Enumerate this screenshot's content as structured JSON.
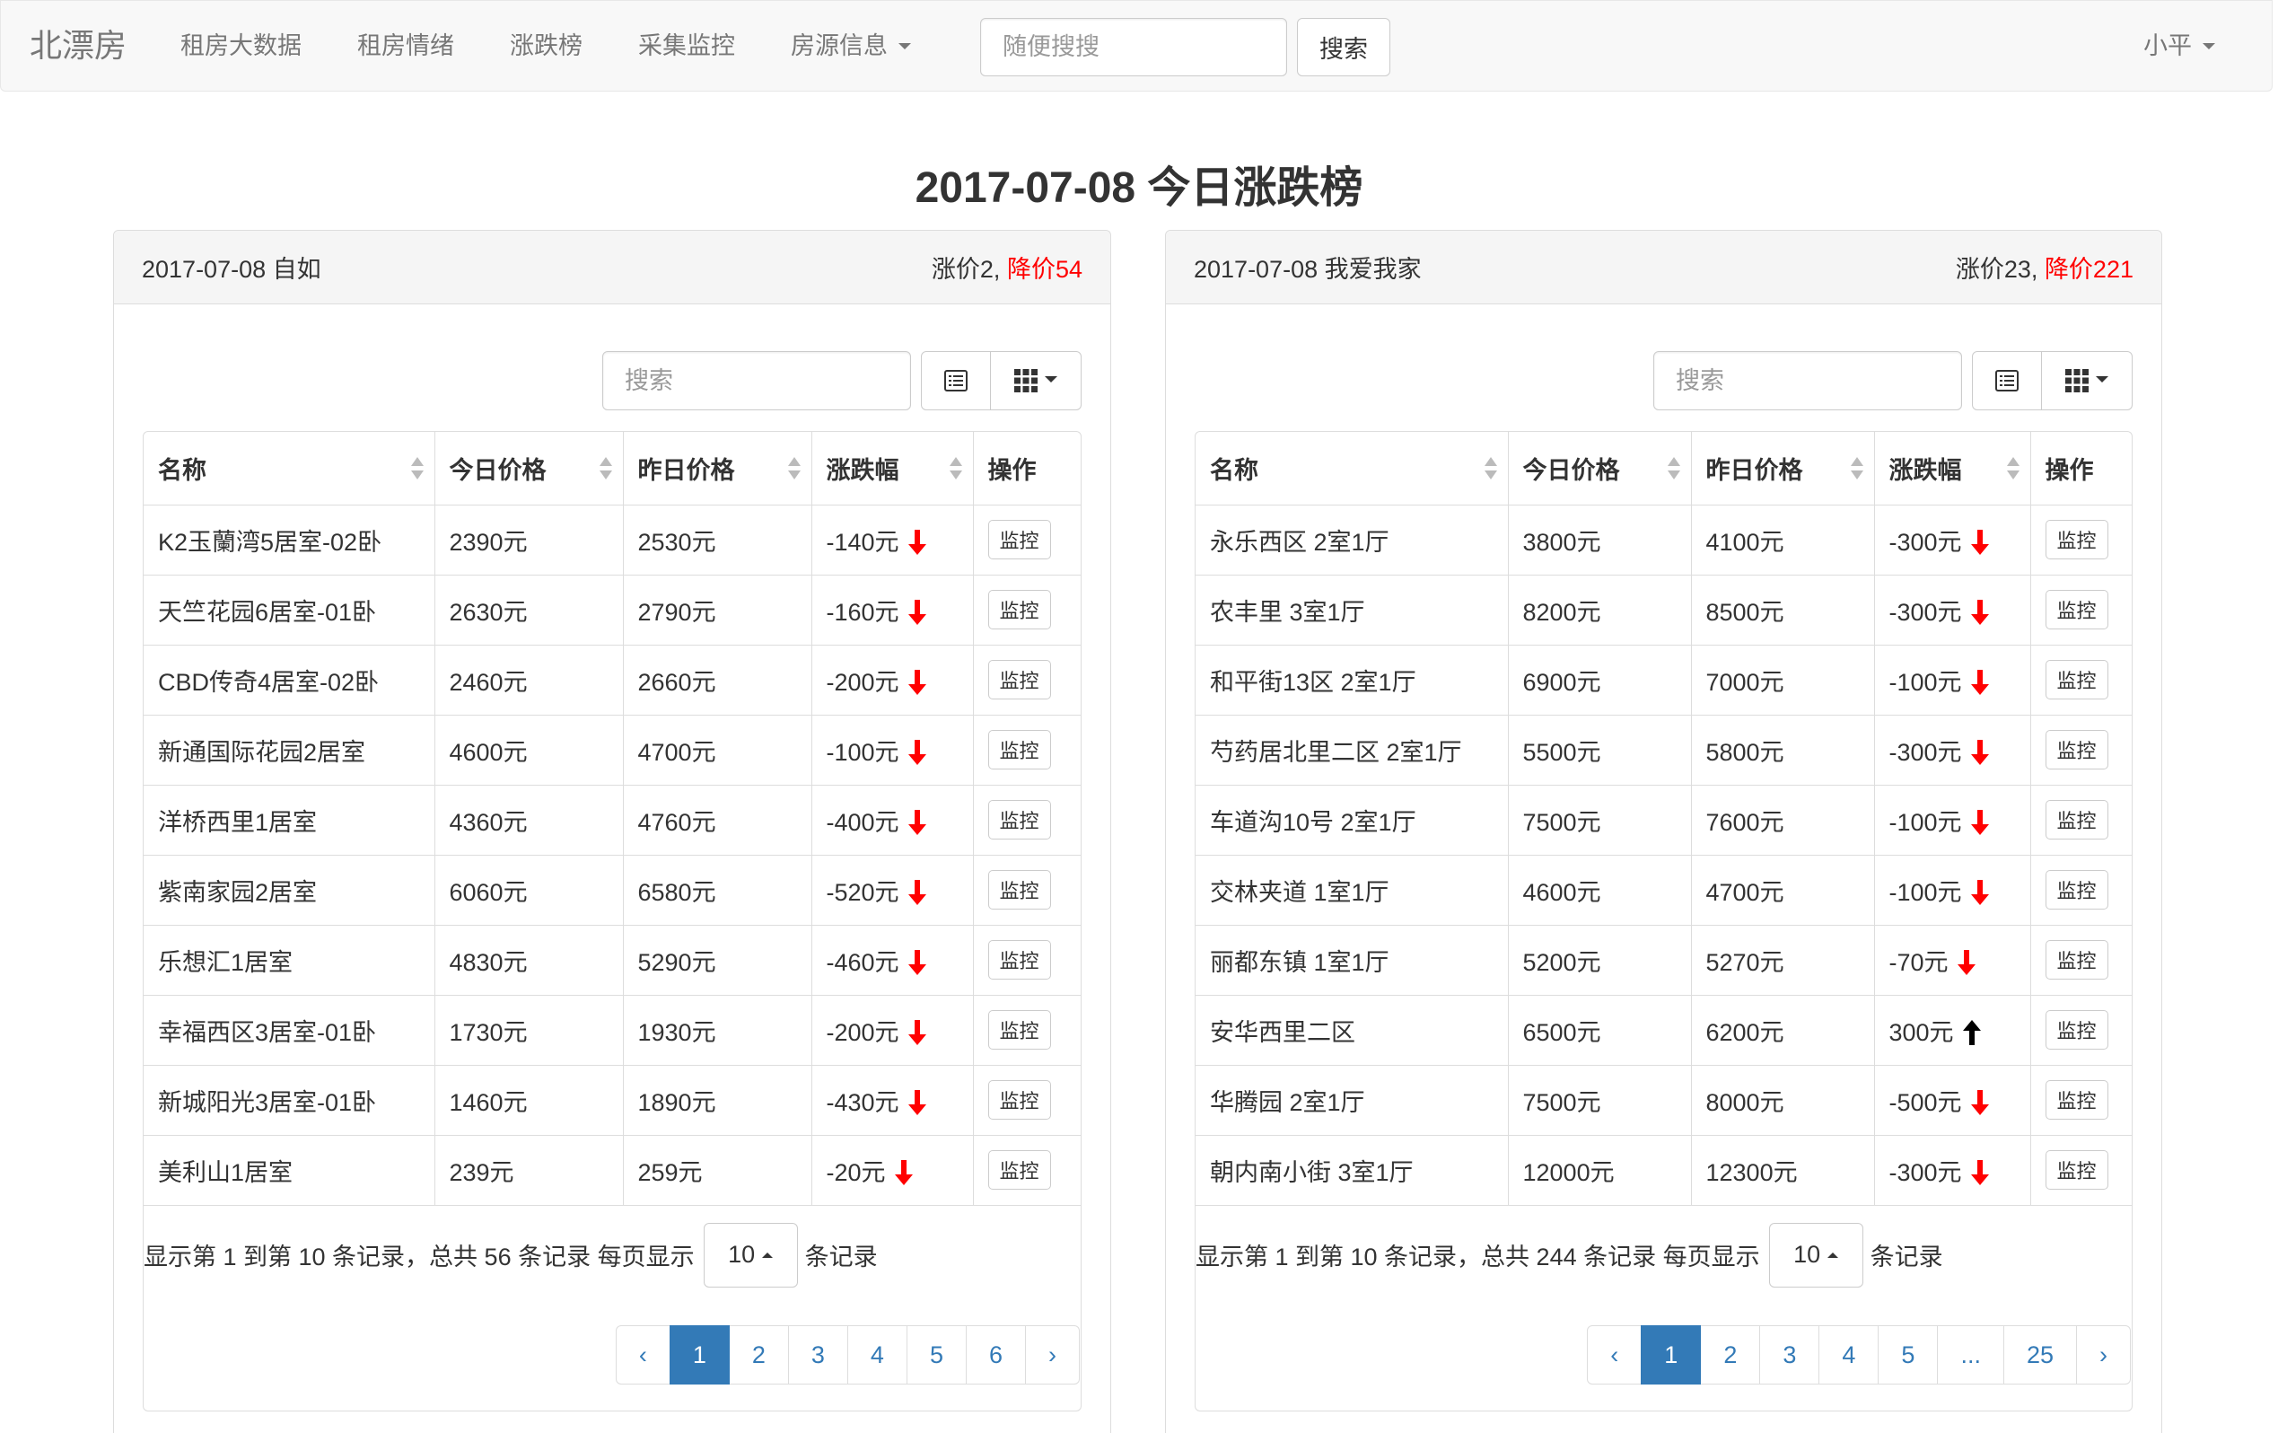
{
  "navbar": {
    "brand": "北漂房",
    "items": [
      {
        "label": "租房大数据"
      },
      {
        "label": "租房情绪"
      },
      {
        "label": "涨跌榜"
      },
      {
        "label": "采集监控"
      },
      {
        "label": "房源信息"
      }
    ],
    "search_placeholder": "随便搜搜",
    "search_button": "搜索",
    "user": "小平"
  },
  "page_title": "2017-07-08 今日涨跌榜",
  "colors": {
    "accent": "#337ab7",
    "fall": "#ff0000",
    "rise": "#000000"
  },
  "panels": [
    {
      "title": "2017-07-08 自如",
      "rise_label": "涨价2,",
      "fall_label": "降价54",
      "search_placeholder": "搜索",
      "columns": [
        "名称",
        "今日价格",
        "昨日价格",
        "涨跌幅",
        "操作"
      ],
      "action_label": "监控",
      "rows": [
        {
          "name": "K2玉蘭湾5居室-02卧",
          "today": "2390元",
          "yesterday": "2530元",
          "change": "-140元",
          "icon": "arrow-down"
        },
        {
          "name": "天竺花园6居室-01卧",
          "today": "2630元",
          "yesterday": "2790元",
          "change": "-160元",
          "icon": "arrow-down"
        },
        {
          "name": "CBD传奇4居室-02卧",
          "today": "2460元",
          "yesterday": "2660元",
          "change": "-200元",
          "icon": "arrow-down"
        },
        {
          "name": "新通国际花园2居室",
          "today": "4600元",
          "yesterday": "4700元",
          "change": "-100元",
          "icon": "arrow-down"
        },
        {
          "name": "洋桥西里1居室",
          "today": "4360元",
          "yesterday": "4760元",
          "change": "-400元",
          "icon": "arrow-down"
        },
        {
          "name": "紫南家园2居室",
          "today": "6060元",
          "yesterday": "6580元",
          "change": "-520元",
          "icon": "arrow-down"
        },
        {
          "name": "乐想汇1居室",
          "today": "4830元",
          "yesterday": "5290元",
          "change": "-460元",
          "icon": "arrow-down"
        },
        {
          "name": "幸福西区3居室-01卧",
          "today": "1730元",
          "yesterday": "1930元",
          "change": "-200元",
          "icon": "arrow-down"
        },
        {
          "name": "新城阳光3居室-01卧",
          "today": "1460元",
          "yesterday": "1890元",
          "change": "-430元",
          "icon": "arrow-down"
        },
        {
          "name": "美利山1居室",
          "today": "239元",
          "yesterday": "259元",
          "change": "-20元",
          "icon": "arrow-down"
        }
      ],
      "pagination": {
        "info": "显示第 1 到第 10 条记录，总共 56 条记录 每页显示",
        "page_size": "10",
        "suffix": "条记录",
        "prev": "‹",
        "next": "›",
        "pages": [
          "1",
          "2",
          "3",
          "4",
          "5",
          "6"
        ],
        "active": "1"
      }
    },
    {
      "title": "2017-07-08 我爱我家",
      "rise_label": "涨价23,",
      "fall_label": "降价221",
      "search_placeholder": "搜索",
      "columns": [
        "名称",
        "今日价格",
        "昨日价格",
        "涨跌幅",
        "操作"
      ],
      "action_label": "监控",
      "rows": [
        {
          "name": "永乐西区 2室1厅",
          "today": "3800元",
          "yesterday": "4100元",
          "change": "-300元",
          "icon": "arrow-down"
        },
        {
          "name": "农丰里 3室1厅",
          "today": "8200元",
          "yesterday": "8500元",
          "change": "-300元",
          "icon": "arrow-down"
        },
        {
          "name": "和平街13区 2室1厅",
          "today": "6900元",
          "yesterday": "7000元",
          "change": "-100元",
          "icon": "arrow-down"
        },
        {
          "name": "芍药居北里二区 2室1厅",
          "today": "5500元",
          "yesterday": "5800元",
          "change": "-300元",
          "icon": "arrow-down"
        },
        {
          "name": "车道沟10号 2室1厅",
          "today": "7500元",
          "yesterday": "7600元",
          "change": "-100元",
          "icon": "arrow-down"
        },
        {
          "name": "交林夹道 1室1厅",
          "today": "4600元",
          "yesterday": "4700元",
          "change": "-100元",
          "icon": "arrow-down"
        },
        {
          "name": "丽都东镇 1室1厅",
          "today": "5200元",
          "yesterday": "5270元",
          "change": "-70元",
          "icon": "arrow-down"
        },
        {
          "name": "安华西里二区",
          "today": "6500元",
          "yesterday": "6200元",
          "change": "300元",
          "icon": "arrow-up"
        },
        {
          "name": "华腾园 2室1厅",
          "today": "7500元",
          "yesterday": "8000元",
          "change": "-500元",
          "icon": "arrow-down"
        },
        {
          "name": "朝内南小街 3室1厅",
          "today": "12000元",
          "yesterday": "12300元",
          "change": "-300元",
          "icon": "arrow-down"
        }
      ],
      "pagination": {
        "info": "显示第 1 到第 10 条记录，总共 244 条记录 每页显示",
        "page_size": "10",
        "suffix": "条记录",
        "prev": "‹",
        "next": "›",
        "pages": [
          "1",
          "2",
          "3",
          "4",
          "5",
          "...",
          "25"
        ],
        "active": "1"
      }
    }
  ]
}
